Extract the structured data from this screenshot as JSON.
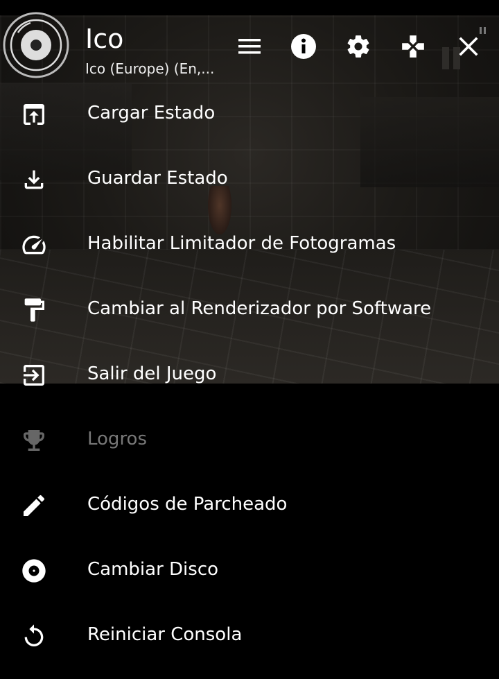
{
  "header": {
    "title": "Ico",
    "subtitle": "Ico (Europe) (En,..."
  },
  "toolbar": {
    "menu_icon": "hamburger-icon",
    "info_icon": "info-icon",
    "settings_icon": "gear-icon",
    "controller_icon": "gamepad-icon",
    "close_icon": "close-icon"
  },
  "menu": {
    "items": [
      {
        "label": "Cargar Estado",
        "icon": "load-state-icon",
        "enabled": true
      },
      {
        "label": "Guardar Estado",
        "icon": "download-icon",
        "enabled": true
      },
      {
        "label": "Habilitar Limitador de Fotogramas",
        "icon": "speedometer-icon",
        "enabled": true
      },
      {
        "label": "Cambiar al Renderizador por Software",
        "icon": "paint-roller-icon",
        "enabled": true
      },
      {
        "label": "Salir del Juego",
        "icon": "exit-icon",
        "enabled": true
      },
      {
        "label": "Logros",
        "icon": "trophy-icon",
        "enabled": false
      },
      {
        "label": "Códigos de Parcheado",
        "icon": "pencil-icon",
        "enabled": true
      },
      {
        "label": "Cambiar Disco",
        "icon": "disc-icon",
        "enabled": true
      },
      {
        "label": "Reiniciar Consola",
        "icon": "restart-icon",
        "enabled": true
      }
    ]
  },
  "colors": {
    "text": "#ffffff",
    "disabled_text": "#777777",
    "background": "#000000"
  }
}
